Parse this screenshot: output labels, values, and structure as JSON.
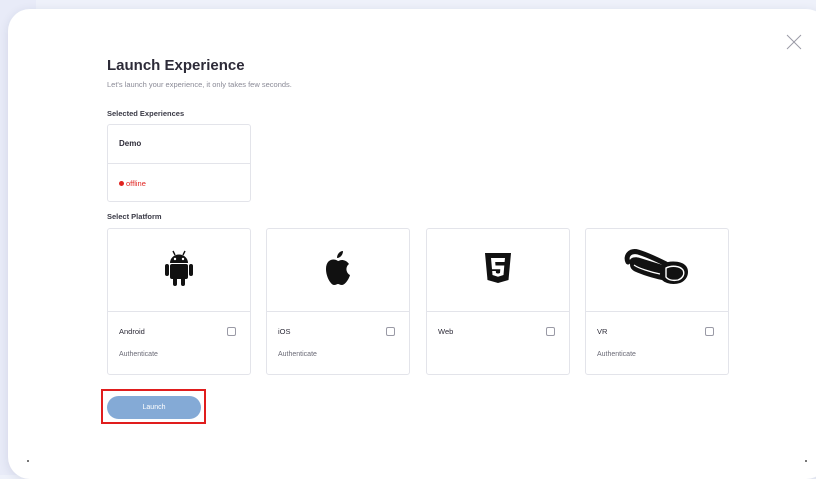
{
  "modal": {
    "title": "Launch Experience",
    "subtitle": "Let's launch your experience, it only takes few seconds.",
    "close_icon": "close-icon"
  },
  "experiences": {
    "label": "Selected Experiences",
    "items": [
      {
        "name": "Demo",
        "status": "offline",
        "status_color": "#e0231f"
      }
    ]
  },
  "platforms": {
    "label": "Select Platform",
    "items": [
      {
        "name": "Android",
        "auth": "Authenticate",
        "icon": "android-icon",
        "checked": false
      },
      {
        "name": "iOS",
        "auth": "Authenticate",
        "icon": "apple-icon",
        "checked": false
      },
      {
        "name": "Web",
        "auth": "",
        "icon": "html5-icon",
        "checked": false
      },
      {
        "name": "VR",
        "auth": "Authenticate",
        "icon": "vr-headset-icon",
        "checked": false
      }
    ]
  },
  "launch": {
    "label": "Launch",
    "color": "#84aad6",
    "highlight_color": "#e01d1d"
  },
  "colors": {
    "background": "#eef1fa",
    "card_border": "#e3e4ea",
    "title": "#2d2b38"
  }
}
